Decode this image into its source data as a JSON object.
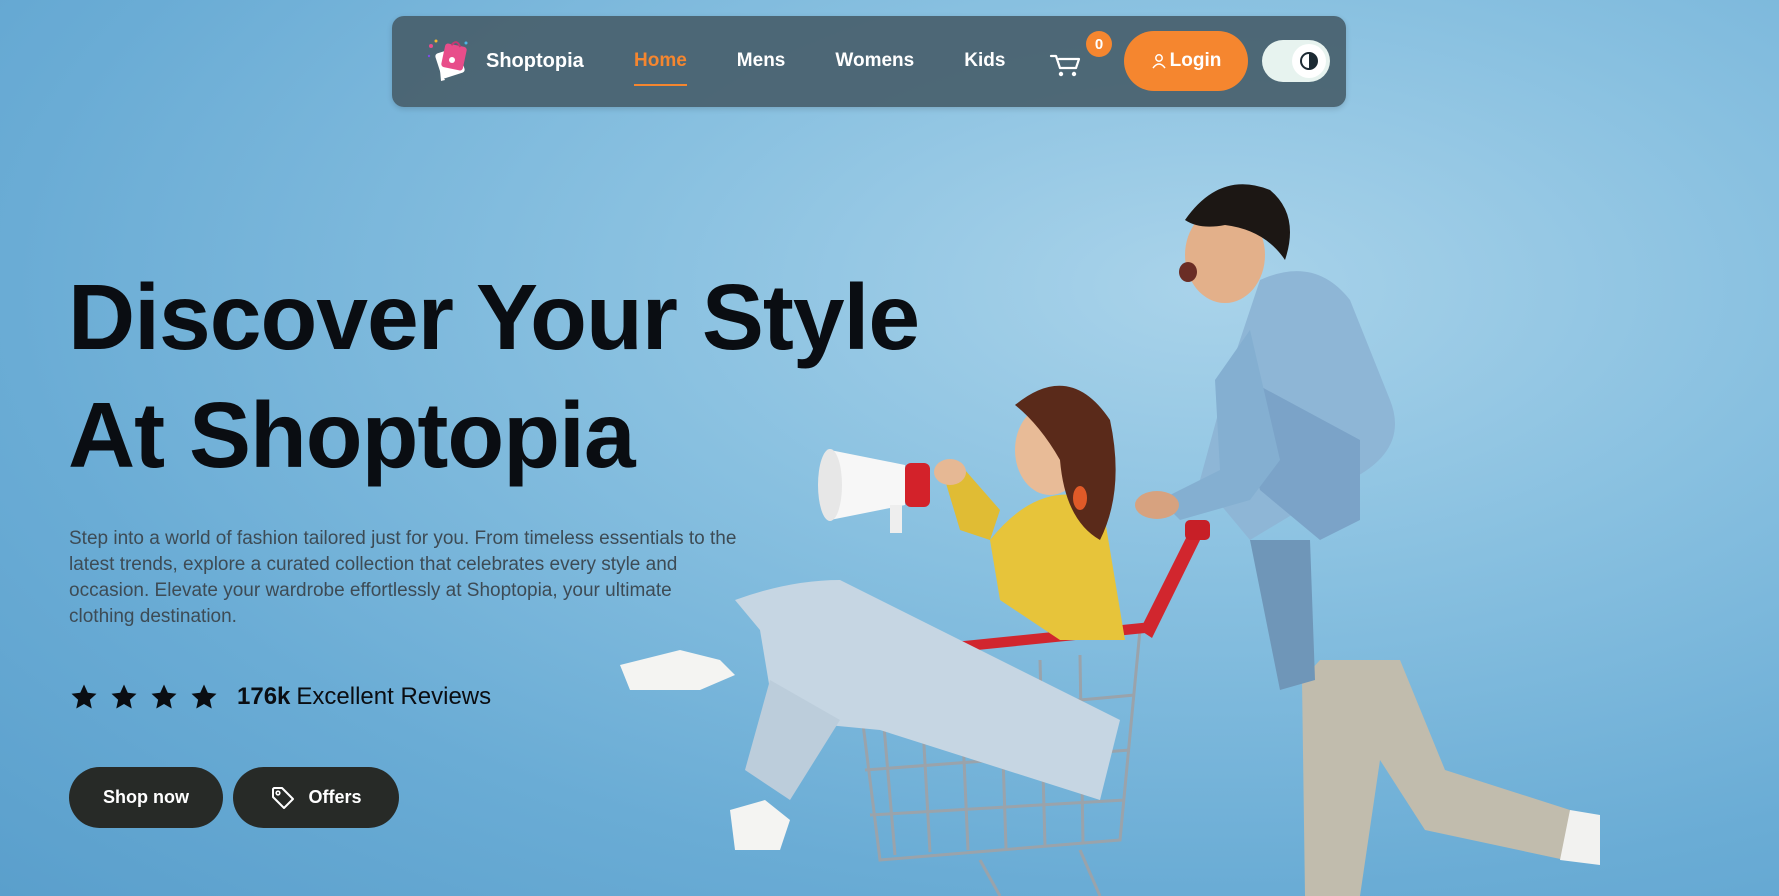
{
  "brand": {
    "name": "Shoptopia",
    "logo_icon": "shopping-bag-icon"
  },
  "nav": {
    "items": [
      {
        "label": "Home",
        "active": true
      },
      {
        "label": "Mens",
        "active": false
      },
      {
        "label": "Womens",
        "active": false
      },
      {
        "label": "Kids",
        "active": false
      }
    ],
    "cart_count": "0",
    "login_label": "Login",
    "theme_toggle": "dark-mode-toggle"
  },
  "hero": {
    "title_line1": "Discover Your Style",
    "title_line2": "At Shoptopia",
    "description": "Step into a world of fashion tailored just for you. From timeless essentials to the latest trends, explore a curated collection that celebrates every style and occasion. Elevate your wardrobe effortlessly at Shoptopia, your ultimate clothing destination.",
    "rating_stars": 4,
    "review_count": "176k",
    "review_label": "Excellent Reviews",
    "shop_label": "Shop now",
    "offers_label": "Offers"
  },
  "colors": {
    "accent": "#f5862f",
    "navbar_bg": "#48606c",
    "button_dark": "#272a27",
    "text_dark": "#0a0d12",
    "background": "#88c0e0"
  }
}
